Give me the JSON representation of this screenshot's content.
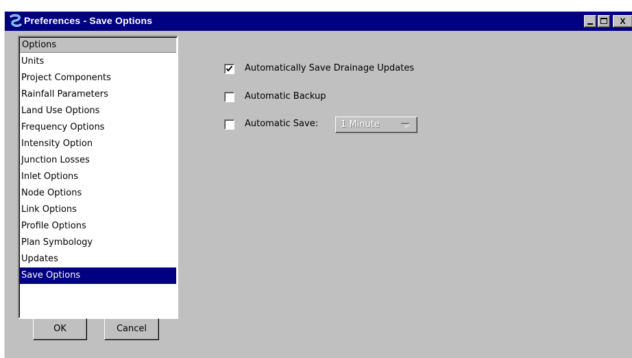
{
  "window": {
    "title": "Preferences - Save Options",
    "controls": {
      "minimize": "minimize",
      "maximize": "maximize",
      "close": "X"
    }
  },
  "options_list": {
    "header": "Options",
    "items": [
      "Units",
      "Project Components",
      "Rainfall Parameters",
      "Land Use Options",
      "Frequency Options",
      "Intensity Option",
      "Junction Losses",
      "Inlet Options",
      "Node Options",
      "Link Options",
      "Profile Options",
      "Plan Symbology",
      "Updates",
      "Save Options"
    ],
    "selected": "Save Options"
  },
  "buttons": {
    "ok": "OK",
    "cancel": "Cancel"
  },
  "save_options": {
    "auto_save_drainage": {
      "label": "Automatically Save Drainage Updates",
      "checked": true
    },
    "auto_backup": {
      "label": "Automatic Backup",
      "checked": false
    },
    "auto_save": {
      "label": "Automatic Save:",
      "checked": false,
      "interval": "1 Minute",
      "interval_enabled": false
    }
  },
  "colors": {
    "titlebar": "#000080",
    "window_bg": "#c0c0c0",
    "selection": "#000080"
  }
}
